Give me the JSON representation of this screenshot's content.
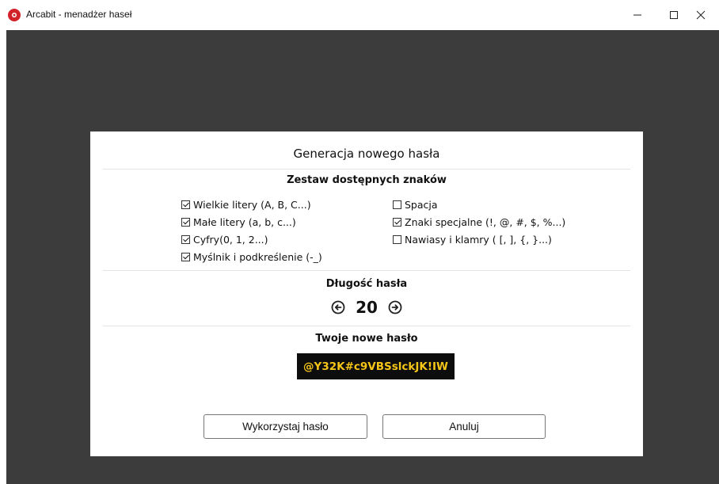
{
  "window": {
    "title": "Arcabit - menadżer haseł"
  },
  "dialog": {
    "title": "Generacja nowego hasła",
    "charset_title": "Zestaw dostępnych znaków",
    "options_left": [
      {
        "label": "Wielkie litery (A, B, C...)",
        "checked": true
      },
      {
        "label": "Małe litery (a, b, c...)",
        "checked": true
      },
      {
        "label": "Cyfry(0, 1, 2...)",
        "checked": true
      },
      {
        "label": "Myślnik i podkreślenie (-_)",
        "checked": true
      }
    ],
    "options_right": [
      {
        "label": "Spacja",
        "checked": false
      },
      {
        "label": "Znaki specjalne (!, @, #, $, %...)",
        "checked": true
      },
      {
        "label": "Nawiasy i klamry ( [, ], {, }...)",
        "checked": false
      }
    ],
    "length_title": "Długość hasła",
    "length_value": "20",
    "password_title": "Twoje nowe hasło",
    "password_value": "@Y32K#c9VBSslckJK!IW",
    "use_button": "Wykorzystaj hasło",
    "cancel_button": "Anuluj"
  },
  "colors": {
    "accent": "#f5c518",
    "brand": "#d2232a",
    "backdrop": "#3c3c3c"
  }
}
